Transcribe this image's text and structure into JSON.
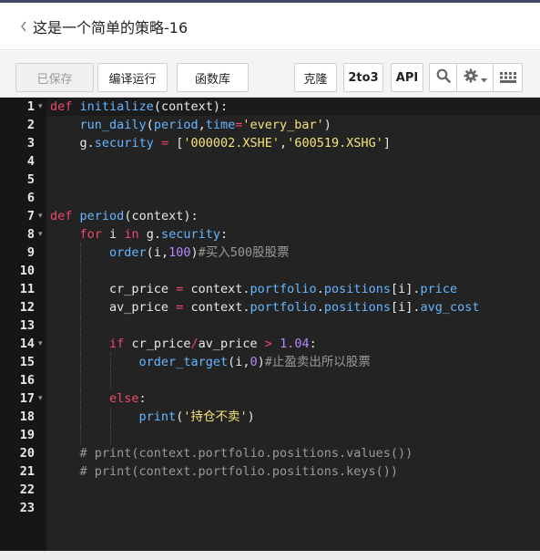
{
  "header": {
    "title": "这是一个简单的策略-16"
  },
  "toolbar": {
    "saved_label": "已保存",
    "compile_run_label": "编译运行",
    "function_lib_label": "函数库",
    "clone_label": "克隆",
    "to3_label": "2to3",
    "api_label": "API",
    "icons": [
      "search-icon",
      "gear-icon",
      "keyboard-icon"
    ]
  },
  "editor": {
    "line_numbers": [
      "1",
      "2",
      "3",
      "4",
      "5",
      "6",
      "7",
      "8",
      "9",
      "10",
      "11",
      "12",
      "13",
      "14",
      "15",
      "16",
      "17",
      "18",
      "19",
      "20",
      "21",
      "22",
      "23"
    ],
    "fold_lines": [
      "1",
      "7",
      "8",
      "14",
      "17"
    ],
    "lines": [
      "def initialize(context):",
      "    run_daily(period,time='every_bar')",
      "    g.security = ['000002.XSHE','600519.XSHG']",
      "",
      "",
      "",
      "def period(context):",
      "    for i in g.security:",
      "        order(i,100)#买入500股股票",
      "",
      "        cr_price = context.portfolio.positions[i].price",
      "        av_price = context.portfolio.positions[i].avg_cost",
      "",
      "        if cr_price/av_price > 1.04:",
      "            order_target(i,0)#止盈卖出所以股票",
      "",
      "        else:",
      "            print('持仓不卖')",
      "",
      "    # print(context.portfolio.positions.values())",
      "    # print(context.portfolio.positions.keys())",
      "",
      ""
    ]
  },
  "colors": {
    "keyword": "#f0486b",
    "function": "#66b6ff",
    "number": "#b884ff",
    "string": "#f5e27a",
    "comment": "#9a9a9a"
  }
}
